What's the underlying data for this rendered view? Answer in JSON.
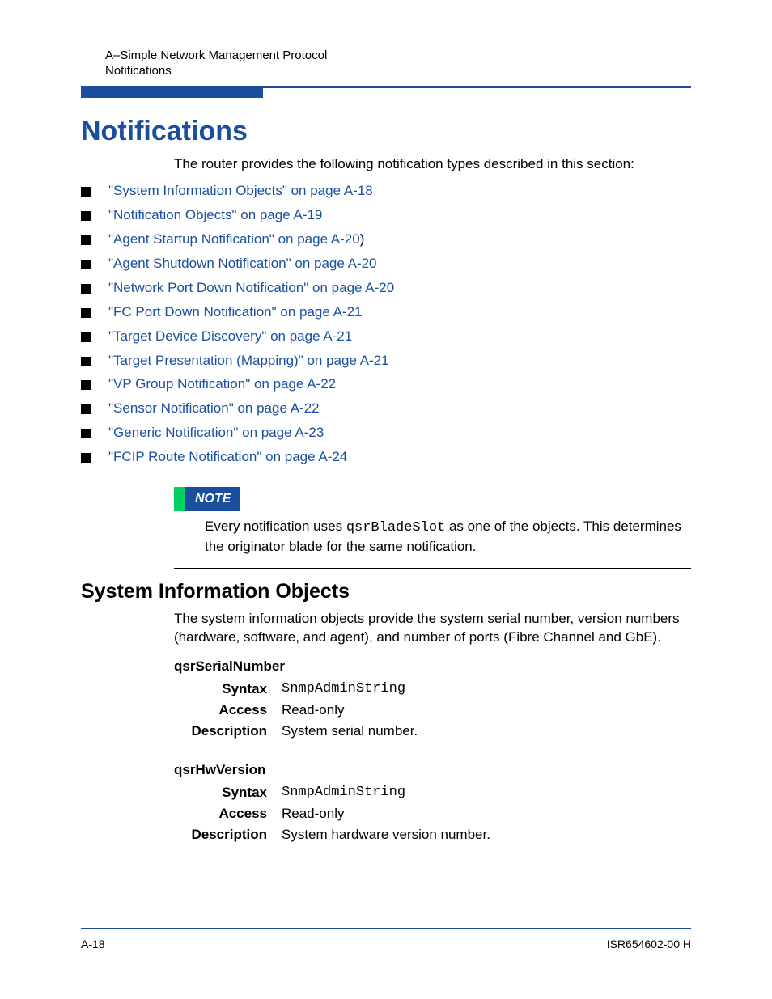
{
  "header": {
    "line1": "A–Simple Network Management Protocol",
    "line2": "Notifications"
  },
  "title": "Notifications",
  "intro": "The router provides the following notification types described in this section:",
  "links": [
    {
      "text": "\"System Information Objects\" on page A-18",
      "suffix": ""
    },
    {
      "text": "\"Notification Objects\" on page A-19",
      "suffix": ""
    },
    {
      "text": "\"Agent Startup Notification\" on page A-20",
      "suffix": ")"
    },
    {
      "text": "\"Agent Shutdown Notification\" on page A-20",
      "suffix": ""
    },
    {
      "text": "\"Network Port Down Notification\" on page A-20",
      "suffix": ""
    },
    {
      "text": "\"FC Port Down Notification\" on page A-21",
      "suffix": ""
    },
    {
      "text": "\"Target Device Discovery\" on page A-21",
      "suffix": ""
    },
    {
      "text": "\"Target Presentation (Mapping)\" on page A-21",
      "suffix": ""
    },
    {
      "text": "\"VP Group Notification\" on page A-22",
      "suffix": ""
    },
    {
      "text": "\"Sensor Notification\" on page A-22",
      "suffix": ""
    },
    {
      "text": "\"Generic Notification\" on page A-23",
      "suffix": ""
    },
    {
      "text": "\"FCIP Route Notification\" on page A-24",
      "suffix": ""
    }
  ],
  "note": {
    "label": "NOTE",
    "pre": "Every notification uses ",
    "code": "qsrBladeSlot",
    "post": " as one of the objects. This determines the originator blade for the same notification."
  },
  "section": {
    "title": "System Information Objects",
    "intro": "The system information objects provide the system serial number, version numbers (hardware, software, and agent), and number of ports (Fibre Channel and GbE)."
  },
  "objects": [
    {
      "name": "qsrSerialNumber",
      "rows": {
        "syntax_label": "Syntax",
        "syntax_value": "SnmpAdminString",
        "access_label": "Access",
        "access_value": "Read-only",
        "desc_label": "Description",
        "desc_value": "System serial number."
      }
    },
    {
      "name": "qsrHwVersion",
      "rows": {
        "syntax_label": "Syntax",
        "syntax_value": "SnmpAdminString",
        "access_label": "Access",
        "access_value": "Read-only",
        "desc_label": "Description",
        "desc_value": "System hardware version number."
      }
    }
  ],
  "footer": {
    "page": "A-18",
    "doc": "ISR654602-00  H"
  }
}
